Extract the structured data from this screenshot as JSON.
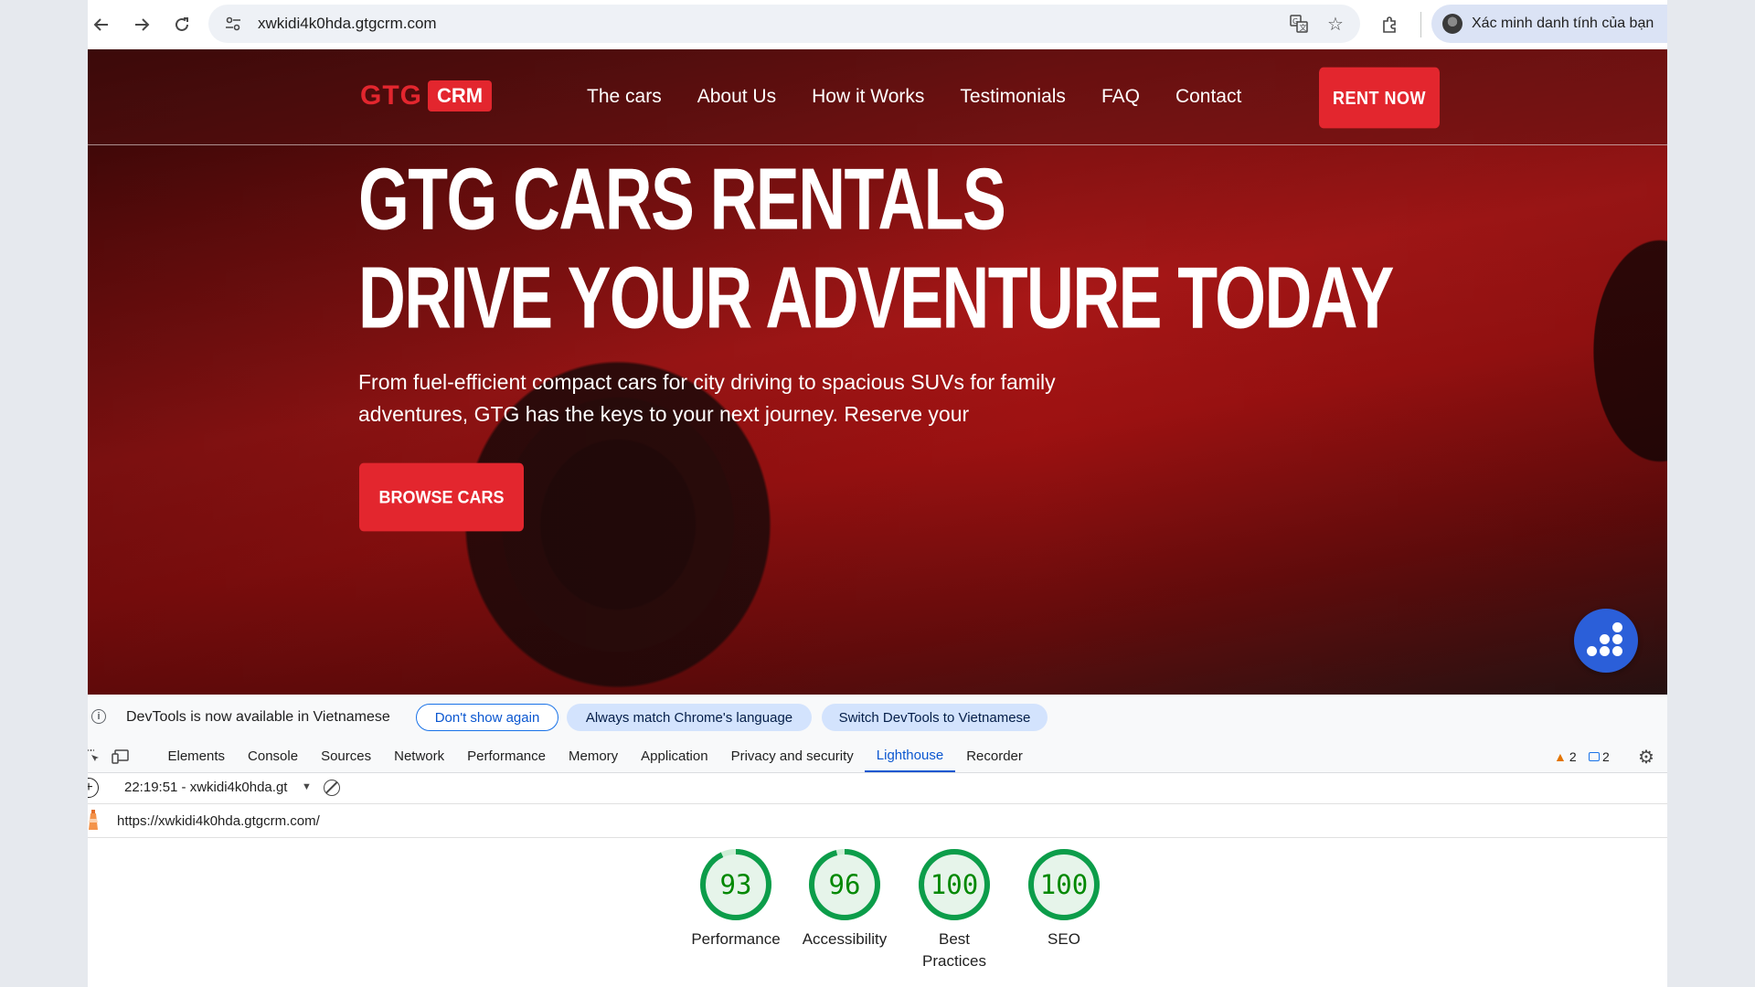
{
  "browser": {
    "url": "xwkidi4k0hda.gtgcrm.com",
    "profile_label": "Xác minh danh tính của bạn",
    "icons": [
      "back-icon",
      "forward-icon",
      "reload-icon",
      "site-settings-icon",
      "translate-icon",
      "bookmark-star-icon",
      "extensions-icon",
      "avatar"
    ]
  },
  "site": {
    "logo_text": "GTG",
    "logo_badge": "CRM",
    "nav": [
      "The cars",
      "About Us",
      "How it Works",
      "Testimonials",
      "FAQ",
      "Contact"
    ],
    "rent_button": "RENT NOW",
    "hero_line1": "GTG CARS RENTALS",
    "hero_line2": "DRIVE YOUR ADVENTURE TODAY",
    "hero_subtitle": "From fuel-efficient compact cars for city driving to spacious SUVs for family adventures, GTG has the keys to your next journey. Reserve your",
    "browse_button": "BROWSE CARS",
    "accent_color": "#e3262e",
    "chat_button_color": "#2b5fd9"
  },
  "devtools": {
    "infobar": {
      "message": "DevTools is now available in Vietnamese",
      "dont_show": "Don't show again",
      "always_match": "Always match Chrome's language",
      "switch": "Switch DevTools to Vietnamese"
    },
    "tabs": [
      "Elements",
      "Console",
      "Sources",
      "Network",
      "Performance",
      "Memory",
      "Application",
      "Privacy and security",
      "Lighthouse",
      "Recorder"
    ],
    "active_tab": "Lighthouse",
    "warnings_count": "2",
    "messages_count": "2",
    "report_selector": "22:19:51 - xwkidi4k0hda.gt",
    "report_url": "https://xwkidi4k0hda.gtgcrm.com/",
    "scores": [
      {
        "label": "Performance",
        "value": 93
      },
      {
        "label": "Accessibility",
        "value": 96
      },
      {
        "label": "Best Practices",
        "value": 100
      },
      {
        "label": "SEO",
        "value": 100
      }
    ],
    "score_color": "#0c9d4a"
  }
}
